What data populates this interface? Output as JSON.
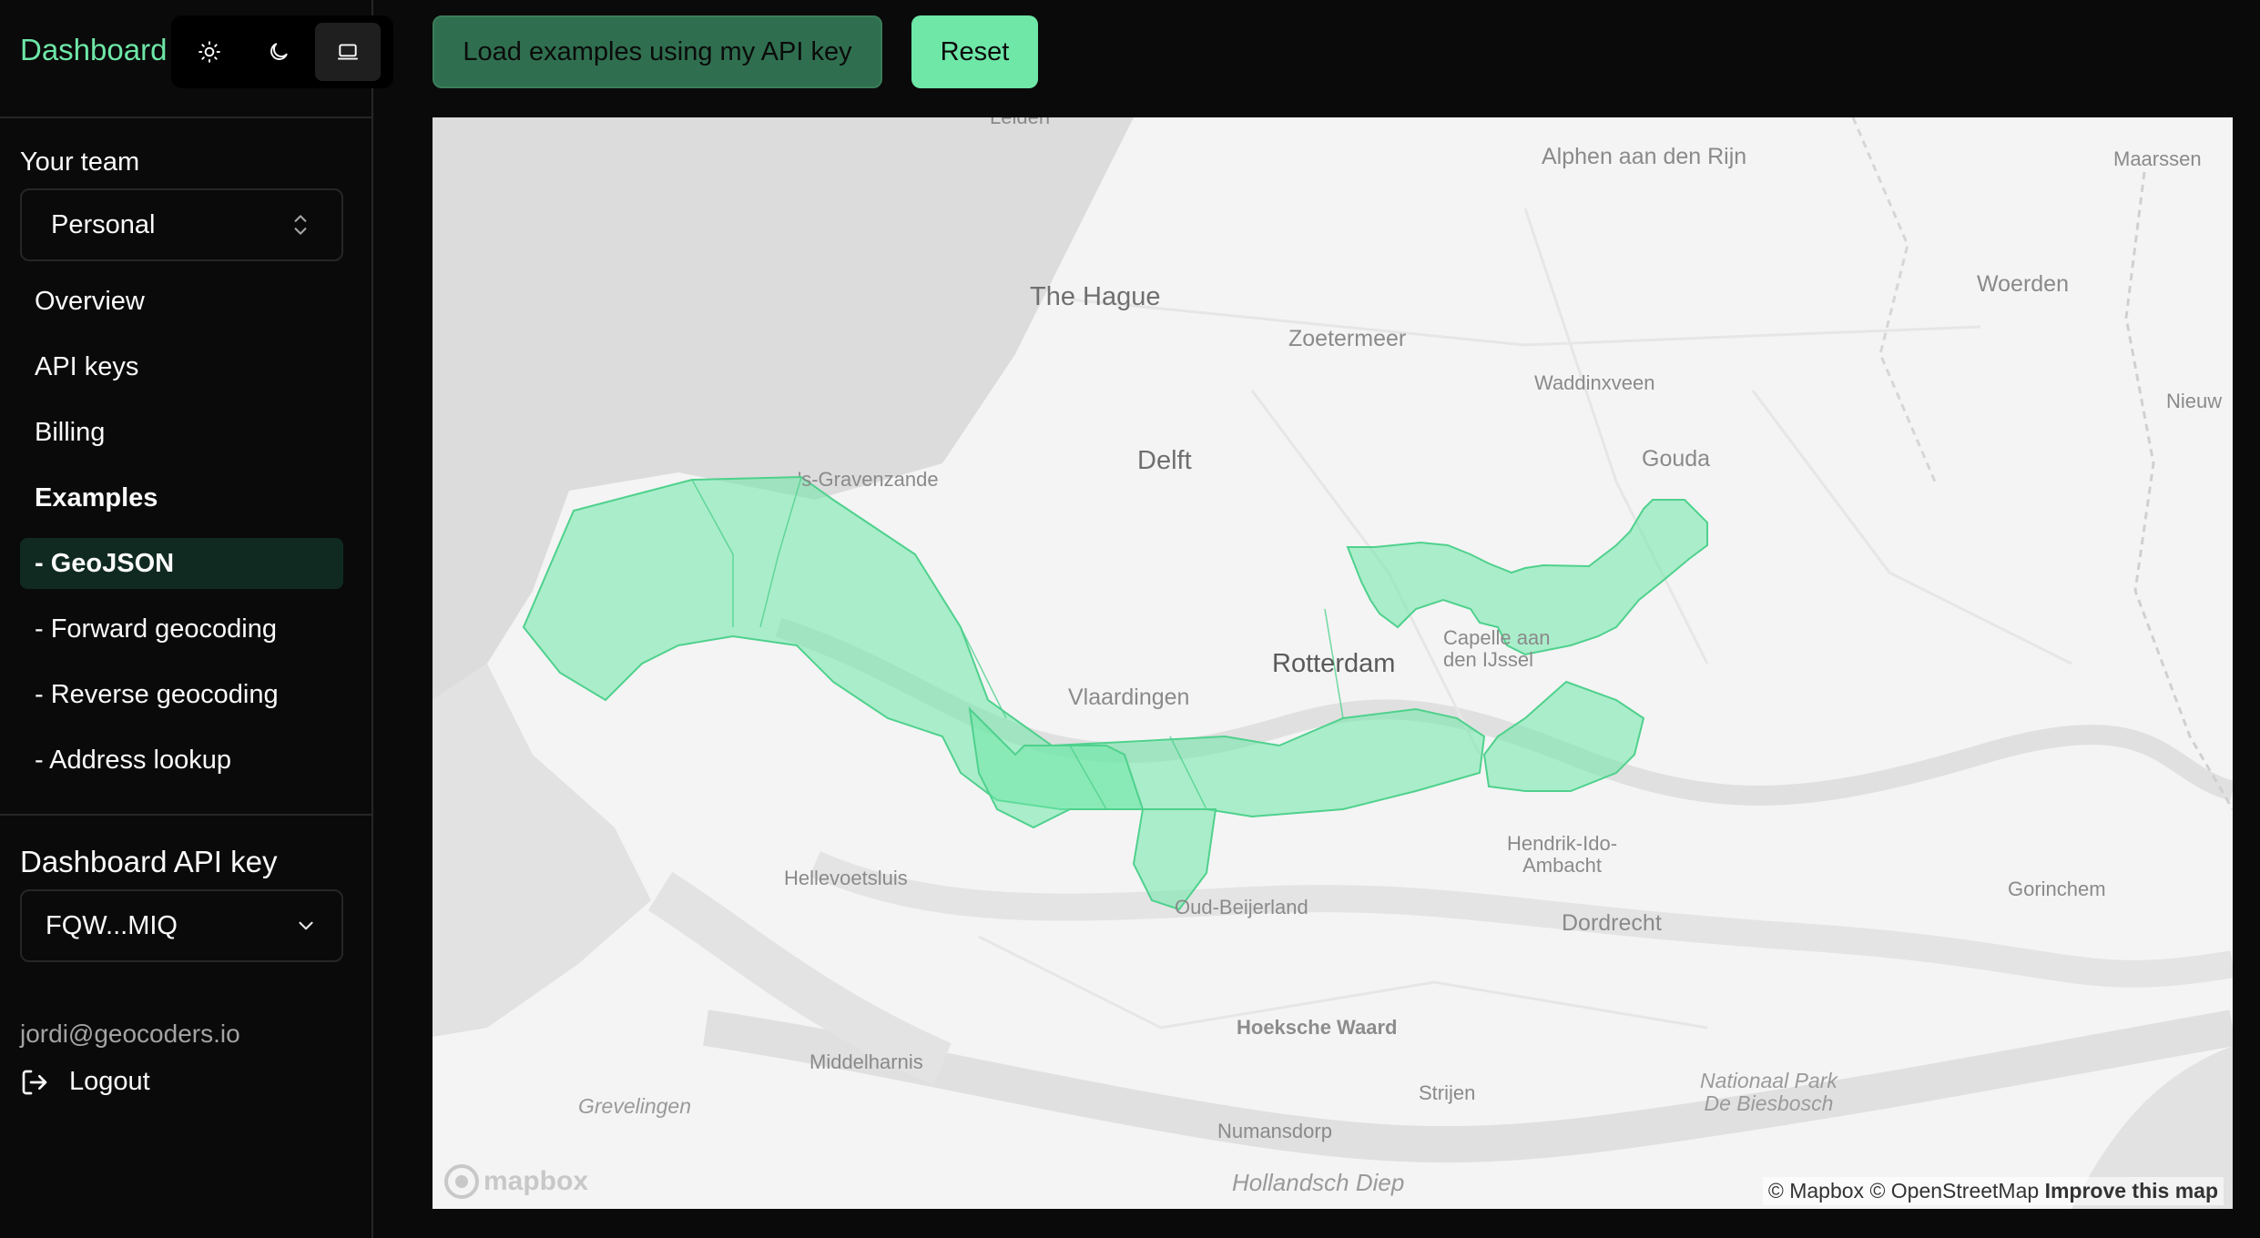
{
  "sidebar": {
    "brand": "Dashboard",
    "theme_icons": [
      "sun-icon",
      "moon-icon",
      "laptop-icon"
    ],
    "team_label": "Your team",
    "team_value": "Personal",
    "nav": [
      {
        "label": "Overview"
      },
      {
        "label": "API keys"
      },
      {
        "label": "Billing"
      },
      {
        "label": "Examples"
      },
      {
        "label": "- GeoJSON"
      },
      {
        "label": "- Forward geocoding"
      },
      {
        "label": "- Reverse geocoding"
      },
      {
        "label": "- Address lookup"
      }
    ],
    "apikey_label": "Dashboard API key",
    "apikey_value": "FQW...MIQ",
    "user_email": "jordi@geocoders.io",
    "logout_label": "Logout"
  },
  "toolbar": {
    "load_examples_label": "Load examples using my API key",
    "reset_label": "Reset"
  },
  "map": {
    "places": {
      "alphen": "Alphen aan\nden Rijn",
      "maarssen": "Maarssen",
      "the_hague": "The Hague",
      "zoetermeer": "Zoetermeer",
      "woerden": "Woerden",
      "waddinxveen": "Waddinxveen",
      "nieuw": "Nieuw",
      "gravenzande": "'s-Gravenzande",
      "delft": "Delft",
      "gouda": "Gouda",
      "capelle": "Capelle aan\nden IJssel",
      "rotterdam": "Rotterdam",
      "vlaardingen": "Vlaardingen",
      "hendrik": "Hendrik-Ido-\nAmbacht",
      "hellevoetsluis": "Hellevoetsluis",
      "oud_beijerland": "Oud-Beijerland",
      "dordrecht": "Dordrecht",
      "gorinchem": "Gorinchem",
      "hoeksche_waard": "Hoeksche Waard",
      "middelharnis": "Middelharnis",
      "biesbosch": "Nationaal Park\nDe Biesbosch",
      "grevelingen": "Grevelingen",
      "strijen": "Strijen",
      "numansdorp": "Numansdorp",
      "hollandsch_diep": "Hollandsch Diep",
      "leiden_partial": "Leiden"
    },
    "attribution_mapbox": "© Mapbox",
    "attribution_osm": "© OpenStreetMap",
    "improve_label": "Improve this map",
    "logo_text": "mapbox",
    "geojson_fill": "#6ee7a7"
  }
}
